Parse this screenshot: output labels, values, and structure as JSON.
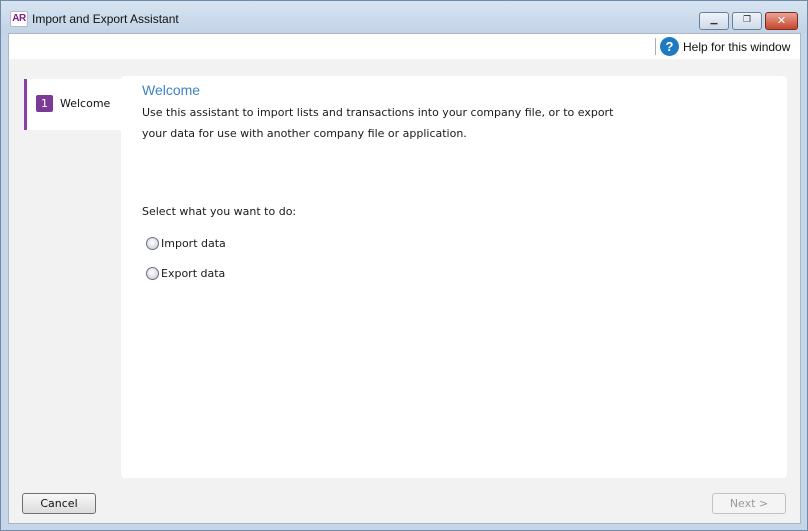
{
  "window": {
    "app_logo": "AR",
    "title": "Import and Export Assistant",
    "minimize_glyph": "▁",
    "maximize_glyph": "❐",
    "close_glyph": "✕"
  },
  "help": {
    "icon": "question-icon",
    "icon_glyph": "?",
    "label": "Help for this window"
  },
  "steps": [
    {
      "number": "1",
      "label": "Welcome"
    }
  ],
  "main": {
    "heading": "Welcome",
    "intro_line1": "Use this assistant to import lists and transactions into your company file, or to export",
    "intro_line2": "your data for use with another company file or application.",
    "prompt": "Select what you want to do:",
    "options": [
      {
        "label": "Import data",
        "selected": false
      },
      {
        "label": "Export data",
        "selected": false
      }
    ]
  },
  "footer": {
    "cancel_label": "Cancel",
    "next_label": "Next >",
    "next_enabled": false
  },
  "colors": {
    "accent_purple": "#7b3b94",
    "heading_blue": "#3f84bf",
    "help_icon_blue": "#1f7bc1"
  }
}
